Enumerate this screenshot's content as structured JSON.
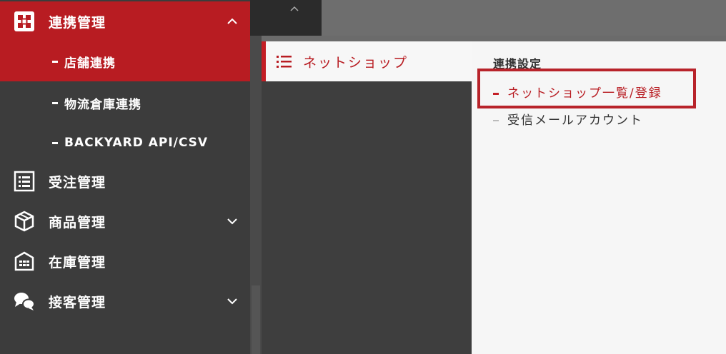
{
  "sidebar": {
    "items": [
      {
        "label": "連携管理",
        "icon": "puzzle-icon",
        "chevron": "chevron-up-icon",
        "active": true
      },
      {
        "label": "受注管理",
        "icon": "list-icon"
      },
      {
        "label": "商品管理",
        "icon": "box-icon",
        "chevron": "chevron-down-icon"
      },
      {
        "label": "在庫管理",
        "icon": "warehouse-icon"
      },
      {
        "label": "接客管理",
        "icon": "chat-icon",
        "chevron": "chevron-down-icon"
      }
    ],
    "subitems": [
      {
        "label": "店舗連携",
        "active": true
      },
      {
        "label": "物流倉庫連携"
      },
      {
        "label": "BACKYARD API/CSV"
      }
    ]
  },
  "middle": {
    "header_label": "ネットショップ",
    "header_icon": "list-icon"
  },
  "right": {
    "section_title": "連携設定",
    "links": [
      {
        "label": "ネットショップ一覧/登録",
        "active": true
      },
      {
        "label": "受信メールアカウント",
        "active": false
      }
    ]
  },
  "colors": {
    "accent": "#b81c22",
    "sidebar_bg": "#3c3c3c",
    "panel_bg": "#f6f6f6"
  }
}
